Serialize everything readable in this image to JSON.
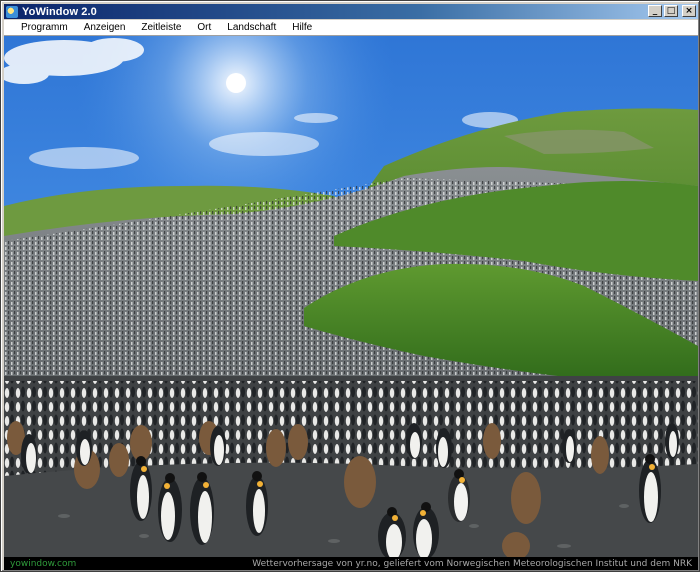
{
  "window": {
    "title": "YoWindow 2.0",
    "buttons": {
      "minimize": "_",
      "maximize": "□",
      "close": "×"
    }
  },
  "menu": {
    "items": [
      "Programm",
      "Anzeigen",
      "Zeitleiste",
      "Ort",
      "Landschaft",
      "Hilfe"
    ]
  },
  "scene": {
    "description_icon": "penguin-colony-landscape",
    "sky_color": "#3d86e0",
    "grass_color": "#4f8a2a"
  },
  "status": {
    "link": "yowindow.com",
    "credit": "Wettervorhersage von yr.no, geliefert vom Norwegischen Meteorologischen Institut und dem NRK"
  }
}
